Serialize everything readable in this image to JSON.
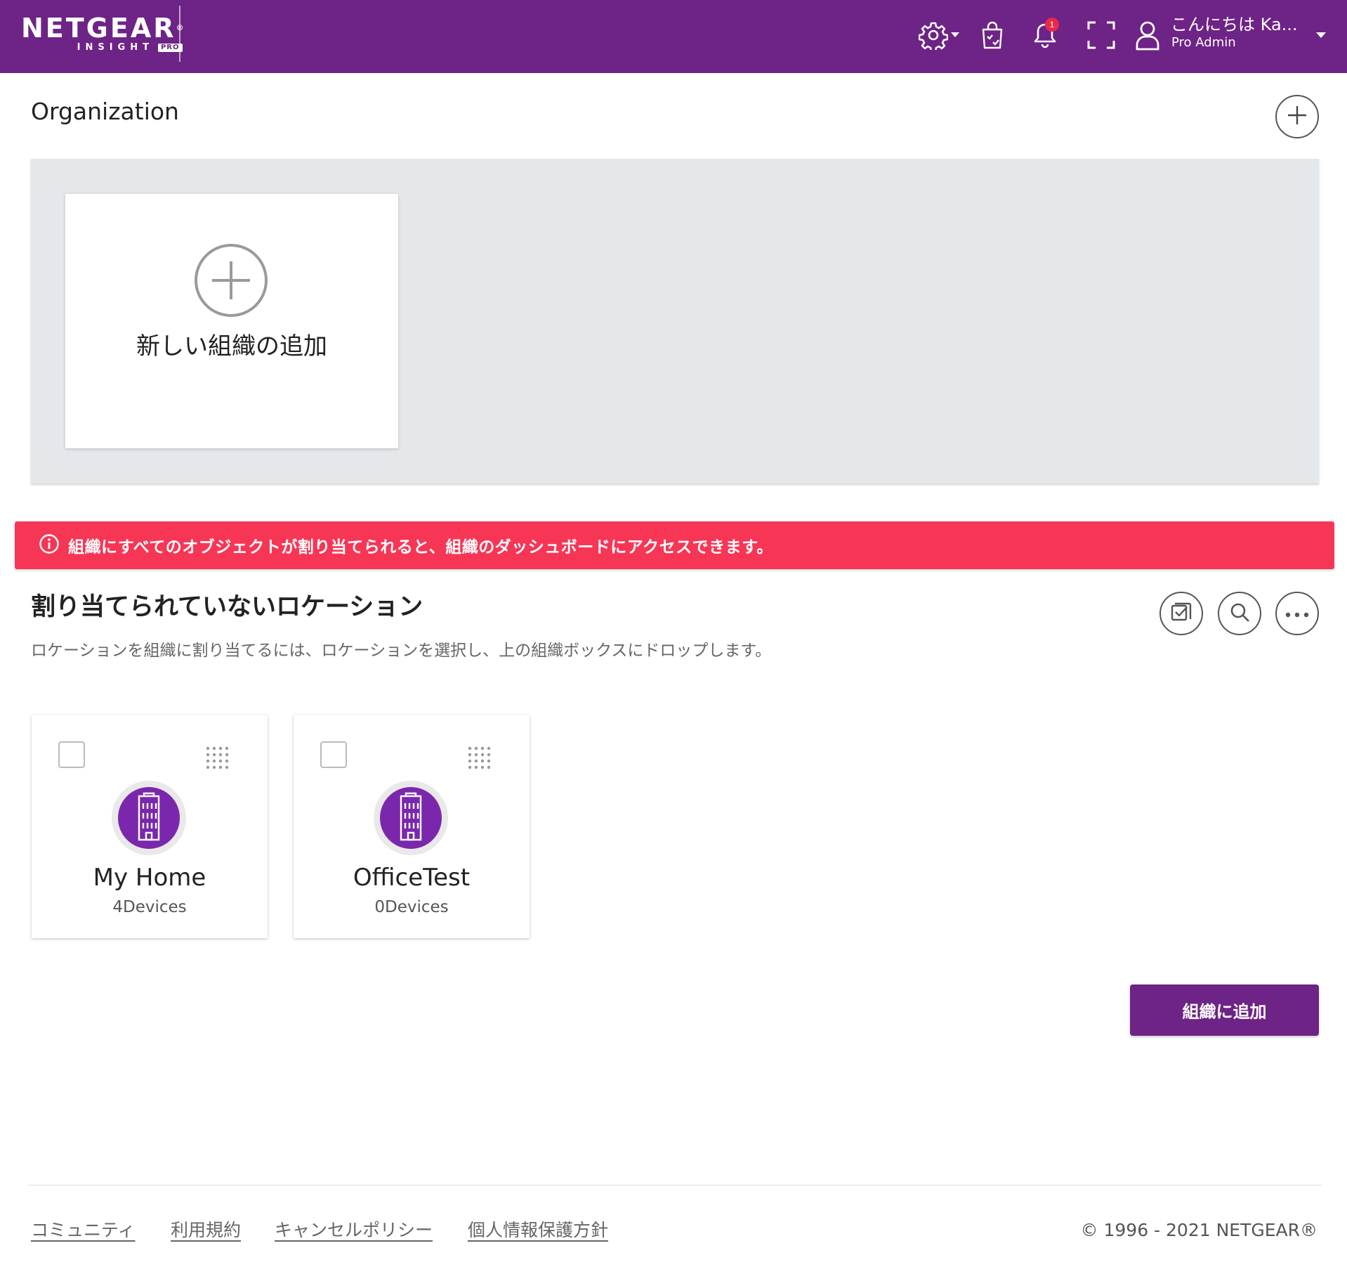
{
  "header": {
    "brand": "NETGEAR",
    "brand_mark": "®",
    "sub_brand": "INSIGHT",
    "pro_tag": "PRO",
    "notification_count": "1",
    "greeting": "こんにちは Ka...",
    "role": "Pro Admin",
    "icons": [
      "gear-icon",
      "shopping-bag-icon",
      "bell-icon",
      "fullscreen-icon",
      "user-icon"
    ]
  },
  "organization": {
    "title": "Organization",
    "add_card_label": "新しい組織の追加"
  },
  "alert": {
    "message": "組織にすべてのオブジェクトが割り当てられると、組織のダッシュボードにアクセスできます。",
    "color": "#f73656"
  },
  "unassigned": {
    "title": "割り当てられていないロケーション",
    "description": "ロケーションを組織に割り当てるには、ロケーションを選択し、上の組織ボックスにドロップします。",
    "locations": [
      {
        "name": "My Home",
        "devices": "4Devices"
      },
      {
        "name": "OfficeTest",
        "devices": "0Devices"
      }
    ],
    "assign_button": "組織に追加"
  },
  "footer": {
    "links": [
      "コミュニティ",
      "利用規約",
      "キャンセルポリシー",
      "個人情報保護方針"
    ],
    "copyright": "© 1996 - 2021 NETGEAR®"
  },
  "colors": {
    "header_bg": "#6e2386",
    "accent_purple": "#7b27ad",
    "panel_bg": "#e4e8eb"
  }
}
